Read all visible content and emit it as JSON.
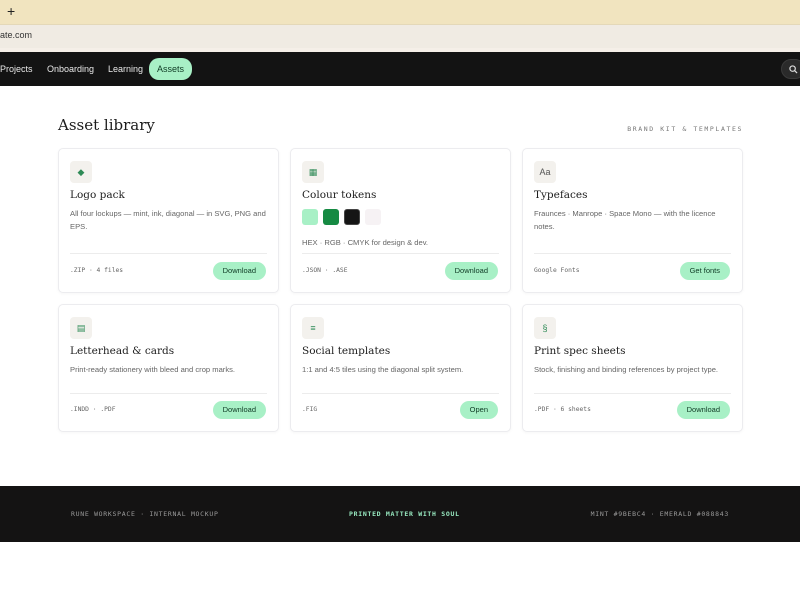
{
  "browser": {
    "new_tab_glyph": "+",
    "url": "ate.com"
  },
  "nav": {
    "items": [
      {
        "label": "Projects"
      },
      {
        "label": "Onboarding"
      },
      {
        "label": "Learning"
      },
      {
        "label": "Assets"
      }
    ],
    "active": "Assets",
    "search_icon": "search-icon"
  },
  "main": {
    "title": "Asset library",
    "kicker": "BRAND KIT & TEMPLATES"
  },
  "cards": [
    {
      "title": "Logo pack",
      "desc": "All four lockups — mint, ink, diagonal — in SVG, PNG and EPS.",
      "meta": ".ZIP · 4 files",
      "button": "Download",
      "icon": "◆"
    },
    {
      "title": "Colour tokens",
      "desc": "HEX · RGB · CMYK for design & dev.",
      "meta": ".JSON · .ASE",
      "button": "Download",
      "icon": "▦"
    },
    {
      "title": "Typefaces",
      "desc": "Fraunces · Manrope · Space Mono — with the licence notes.",
      "meta": "Google Fonts",
      "button": "Get fonts",
      "icon": "Aa"
    },
    {
      "title": "Letterhead & cards",
      "desc": "Print-ready stationery with bleed and crop marks.",
      "meta": ".INDD · .PDF",
      "button": "Download",
      "icon": "▤"
    },
    {
      "title": "Social templates",
      "desc": "1:1 and 4:5 tiles using the diagonal split system.",
      "meta": ".FIG",
      "button": "Open",
      "icon": "≡"
    },
    {
      "title": "Print spec sheets",
      "desc": "Stock, finishing and binding references by project type.",
      "meta": ".PDF · 6 sheets",
      "button": "Download",
      "icon": "§"
    }
  ],
  "swatch_colors": [
    "#a8f0c6",
    "#168a43",
    "#151515",
    "#f6f2f4"
  ],
  "footer": {
    "left": "RUNE WORKSPACE · INTERNAL MOCKUP",
    "center": "PRINTED MATTER WITH SOUL",
    "right": "MINT #9BEBC4 · EMERALD #088843"
  }
}
